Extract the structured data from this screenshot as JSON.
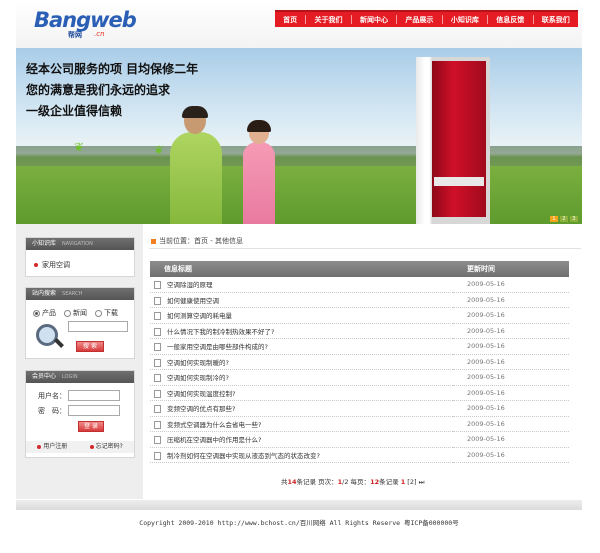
{
  "logo": {
    "brand": "Bangweb",
    "cn": "帮网",
    "domain": ".cn"
  },
  "nav": [
    "首页",
    "关于我们",
    "新闻中心",
    "产品展示",
    "小知识库",
    "信息反馈",
    "联系我们"
  ],
  "banner": {
    "line1": "经本公司服务的项 目均保修二年",
    "line2": "您的满意是我们永远的追求",
    "line3": "一级企业值得信赖",
    "dots": [
      "1",
      "2",
      "3"
    ]
  },
  "knowledge": {
    "title": "小知识库",
    "title_en": "NAVIGATION",
    "item": "家用空调"
  },
  "search": {
    "title": "站内搜索",
    "title_en": "SEARCH",
    "options": [
      "产品",
      "新闻",
      "下载"
    ],
    "button": "搜 索"
  },
  "member": {
    "title": "会员中心",
    "title_en": "LOGIN",
    "user_label": "用户名：",
    "pass_label": "密　码：",
    "button": "登 录",
    "register": "用户注册",
    "forgot": "忘记密码?"
  },
  "main": {
    "breadcrumb": "当前位置：首页 - 其他信息",
    "col_title": "信息标题",
    "col_time": "更新时间",
    "rows": [
      {
        "title": "空调除湿的原理",
        "date": "2009-05-16"
      },
      {
        "title": "如何健康使用空调",
        "date": "2009-05-16"
      },
      {
        "title": "如何测算空调的耗电量",
        "date": "2009-05-16"
      },
      {
        "title": "什么情况下我的制冷制热效果不好了?",
        "date": "2009-05-16"
      },
      {
        "title": "一般家用空调是由哪些部件构成的?",
        "date": "2009-05-16"
      },
      {
        "title": "空调如何实现制暖的?",
        "date": "2009-05-16"
      },
      {
        "title": "空调如何实现制冷的?",
        "date": "2009-05-16"
      },
      {
        "title": "空调如何实现温度控制?",
        "date": "2009-05-16"
      },
      {
        "title": "变频空调的优点有那些?",
        "date": "2009-05-16"
      },
      {
        "title": "变频式空调器为什么会省电一些?",
        "date": "2009-05-16"
      },
      {
        "title": "压缩机在空调器中的作用是什么?",
        "date": "2009-05-16"
      },
      {
        "title": "制冷剂如何在空调器中实现从液态到气态的状态改变?",
        "date": "2009-05-16"
      }
    ],
    "pager": {
      "total_pre": "共",
      "total": "14",
      "total_suf": "条记录  页次：",
      "page": "1",
      "page_sep": "/2  每页：",
      "per": "12",
      "per_suf": "条记录  ",
      "pages": "1",
      "next": "[2]",
      "last": "⏭"
    }
  },
  "footer": "Copyright 2009-2010 http://www.bchost.cn/百川网络 All Rights Reserve 粤ICP备000000号"
}
